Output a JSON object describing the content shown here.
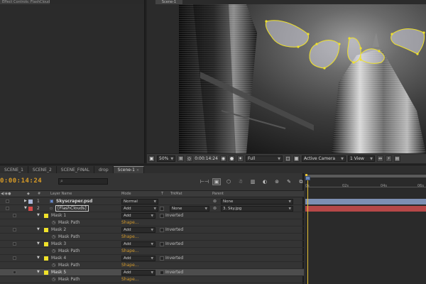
{
  "left_panel": {
    "tab_label": "Effect Controls: FlashClouds"
  },
  "comp_panel": {
    "tab_label": "Scene-1"
  },
  "viewer_bar": {
    "zoom": "50%",
    "timecode": "0:00:14:24",
    "resolution": "Full",
    "camera": "Active Camera",
    "views": "1 View"
  },
  "timeline_tabs": [
    {
      "label": "SCENE_1"
    },
    {
      "label": "SCENE_2"
    },
    {
      "label": "SCENE_FINAL"
    },
    {
      "label": "drop"
    },
    {
      "label": "Scene-1",
      "active": true
    }
  ],
  "timeline": {
    "timecode": "0:00:14:24",
    "search_placeholder": "",
    "columns": {
      "layer_name": "Layer Name",
      "mode": "Mode",
      "t": "T",
      "trkmat": "TrkMat",
      "parent": "Parent"
    },
    "layers": [
      {
        "num": "1",
        "name": "Skyscraper.psd",
        "mode": "Normal",
        "trkmat": "",
        "parent": "None",
        "label_color": "#a9b5d6"
      },
      {
        "num": "2",
        "name": "[FlashClouds]",
        "mode": "Add",
        "trkmat": "None",
        "parent": "3. Sky.jpg",
        "label_color": "#d64949"
      }
    ],
    "masks": [
      {
        "name": "Mask 1",
        "mode": "Add",
        "inverted": "Inverted",
        "path_label": "Mask Path",
        "shape": "Shape..."
      },
      {
        "name": "Mask 2",
        "mode": "Add",
        "inverted": "Inverted",
        "path_label": "Mask Path",
        "shape": "Shape..."
      },
      {
        "name": "Mask 3",
        "mode": "Add",
        "inverted": "Inverted",
        "path_label": "Mask Path",
        "shape": "Shape..."
      },
      {
        "name": "Mask 4",
        "mode": "Add",
        "inverted": "Inverted",
        "path_label": "Mask Path",
        "shape": "Shape..."
      },
      {
        "name": "Mask 5",
        "mode": "Add",
        "inverted": "Inverted",
        "path_label": "Mask Path",
        "shape": "Shape..."
      }
    ],
    "ruler_ticks": [
      "0s",
      "02s",
      "04s",
      "06s"
    ],
    "colors": {
      "timecode": "#d89b26",
      "mask_yellow": "#f0e22a",
      "shape_link": "#d49a2b",
      "cti": "#e7c230"
    }
  }
}
